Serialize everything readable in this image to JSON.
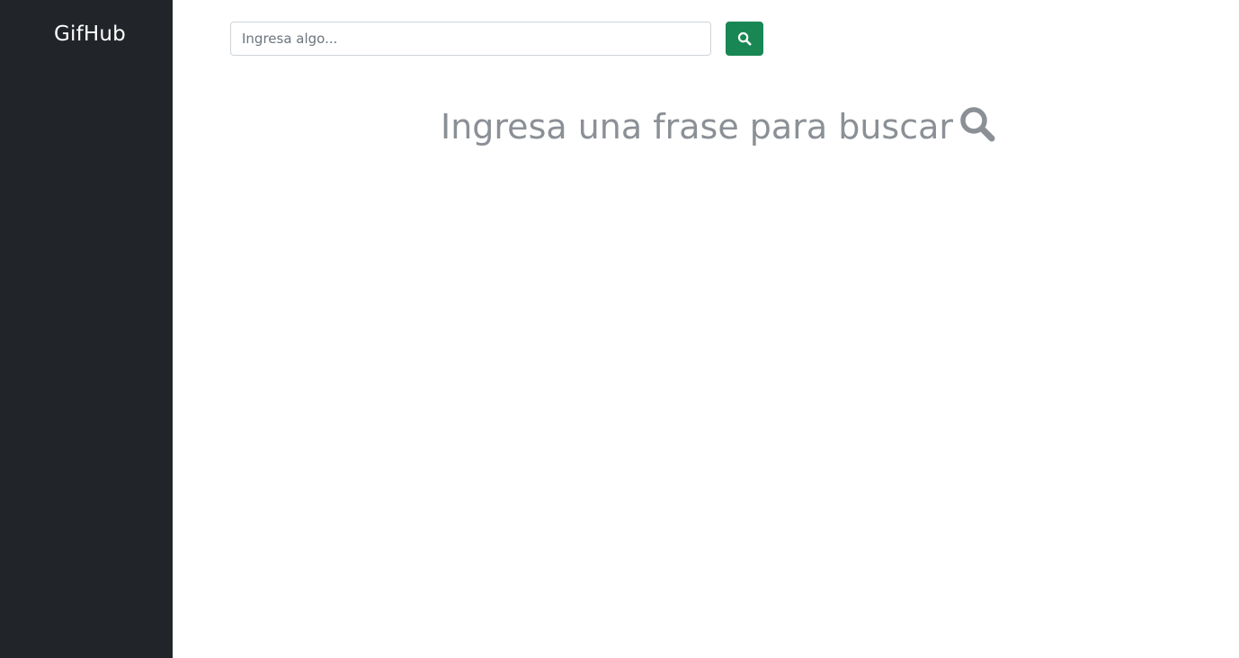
{
  "sidebar": {
    "brand": "GifHub"
  },
  "search": {
    "placeholder": "Ingresa algo...",
    "value": "",
    "button_icon": "search-icon"
  },
  "empty_state": {
    "message": "Ingresa una frase para buscar",
    "icon": "search-icon"
  },
  "colors": {
    "sidebar_bg": "#212529",
    "brand_text": "#ffffff",
    "button_bg": "#198754",
    "prompt_text": "#8b9096"
  }
}
